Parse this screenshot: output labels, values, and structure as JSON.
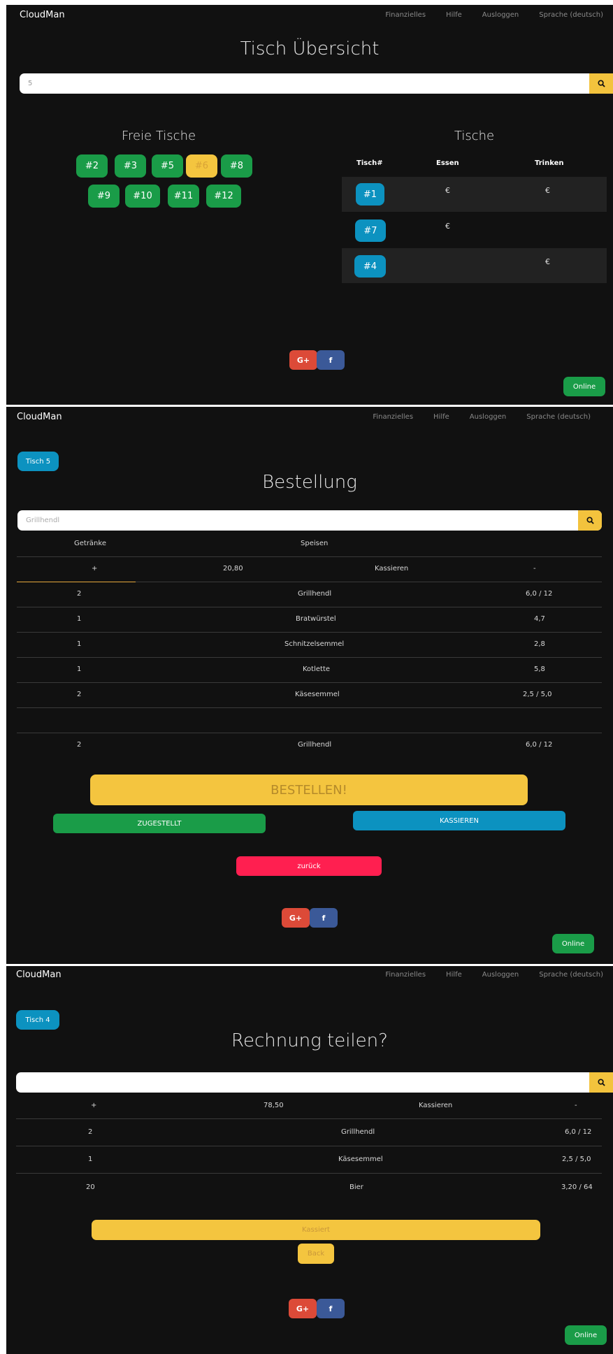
{
  "nav": {
    "brand": "CloudMan",
    "links": [
      "Finanzielles",
      "Hilfe",
      "Ausloggen",
      "Sprache (deutsch)"
    ]
  },
  "colors": {
    "green": "#1a9c48",
    "blue": "#0c92c0",
    "yellow": "#f4c53f",
    "red": "#ff1f50",
    "background": "#111111"
  },
  "screen1": {
    "title": "Tisch Übersicht",
    "search_value": "5",
    "free_title": "Freie Tische",
    "free_tables_row1": [
      "#2",
      "#3",
      "#5",
      "#6",
      "#8"
    ],
    "free_tables_row2": [
      "#9",
      "#10",
      "#11",
      "#12"
    ],
    "selected_table": "#6",
    "tables_title": "Tische",
    "headers": [
      "Tisch#",
      "Essen",
      "Trinken"
    ],
    "rows": [
      {
        "table": "#1",
        "essen": "€",
        "trinken": "€"
      },
      {
        "table": "#7",
        "essen": "€",
        "trinken": ""
      },
      {
        "table": "#4",
        "essen": "",
        "trinken": "€"
      }
    ],
    "social": [
      "G+",
      "f"
    ],
    "status": "Online"
  },
  "screen2": {
    "table_badge": "Tisch 5",
    "title": "Bestellung",
    "search_placeholder": "Grillhendl",
    "tabs": [
      "Getränke",
      "Speisen"
    ],
    "summary": {
      "plus": "+",
      "total": "20,80",
      "action": "Kassieren",
      "minus": "-"
    },
    "items": [
      {
        "qty": "2",
        "name": "Grillhendl",
        "price": "6,0 / 12"
      },
      {
        "qty": "1",
        "name": "Bratwürstel",
        "price": "4,7"
      },
      {
        "qty": "1",
        "name": "Schnitzelsemmel",
        "price": "2,8"
      },
      {
        "qty": "1",
        "name": "Kotlette",
        "price": "5,8"
      },
      {
        "qty": "2",
        "name": "Käsesemmel",
        "price": "2,5 / 5,0"
      }
    ],
    "new_item": {
      "qty": "2",
      "name": "Grillhendl",
      "price": "6,0 / 12"
    },
    "order_button": "BESTELLEN!",
    "delivered_button": "ZUGESTELLT",
    "checkout_button": "KASSIEREN",
    "back_button": "zurück",
    "social": [
      "G+",
      "f"
    ],
    "status": "Online"
  },
  "screen3": {
    "table_badge": "Tisch 4",
    "title": "Rechnung teilen?",
    "search_value": "",
    "summary": {
      "plus": "+",
      "total": "78,50",
      "action": "Kassieren",
      "minus": "-"
    },
    "items": [
      {
        "qty": "2",
        "name": "Grillhendl",
        "price": "6,0 / 12"
      },
      {
        "qty": "1",
        "name": "Käsesemmel",
        "price": "2,5 / 5,0"
      },
      {
        "qty": "20",
        "name": "Bier",
        "price": "3,20 / 64"
      }
    ],
    "paid_button": "Kassiert",
    "back_button": "Back",
    "social": [
      "G+",
      "f"
    ],
    "status": "Online"
  }
}
